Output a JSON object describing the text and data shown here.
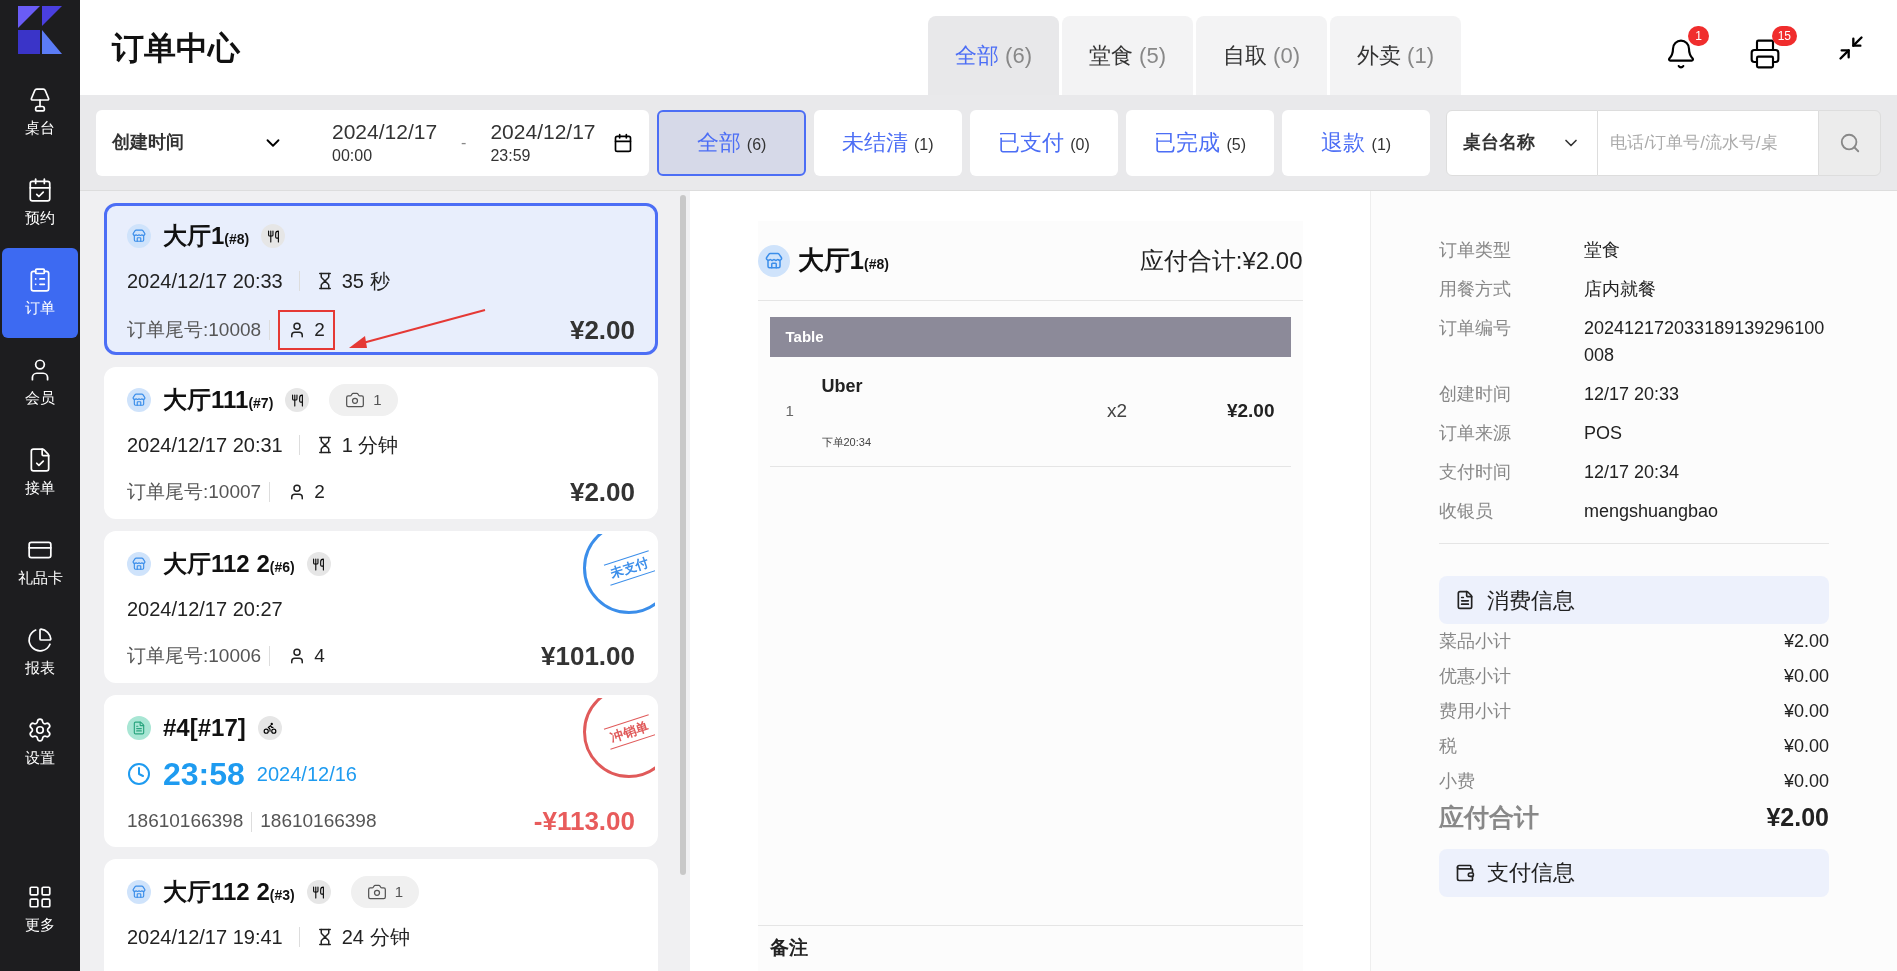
{
  "sidebar": {
    "items": [
      {
        "label": "桌台",
        "selected": false
      },
      {
        "label": "预约",
        "selected": false
      },
      {
        "label": "订单",
        "selected": true
      },
      {
        "label": "会员",
        "selected": false
      },
      {
        "label": "接单",
        "selected": false
      },
      {
        "label": "礼品卡",
        "selected": false
      },
      {
        "label": "报表",
        "selected": false
      },
      {
        "label": "设置",
        "selected": false
      },
      {
        "label": "更多",
        "selected": false
      }
    ]
  },
  "header": {
    "title": "订单中心",
    "tabs": [
      {
        "label": "全部",
        "count": "(6)",
        "selected": true
      },
      {
        "label": "堂食",
        "count": "(5)",
        "selected": false
      },
      {
        "label": "自取",
        "count": "(0)",
        "selected": false
      },
      {
        "label": "外卖",
        "count": "(1)",
        "selected": false
      }
    ],
    "notification_badge": "1",
    "print_badge": "15"
  },
  "filter": {
    "date_type": "创建时间",
    "start_date": "2024/12/17",
    "start_time": "00:00",
    "separator": "-",
    "end_date": "2024/12/17",
    "end_time": "23:59",
    "status_tabs": [
      {
        "label": "全部",
        "count": "(6)",
        "selected": true
      },
      {
        "label": "未结清",
        "count": "(1)",
        "selected": false
      },
      {
        "label": "已支付",
        "count": "(0)",
        "selected": false
      },
      {
        "label": "已完成",
        "count": "(5)",
        "selected": false
      },
      {
        "label": "退款",
        "count": "(1)",
        "selected": false
      }
    ],
    "search_type": "桌台名称",
    "search_placeholder": "电话/订单号/流水号/桌"
  },
  "orders": [
    {
      "kind": "dine_in",
      "selected": true,
      "table": "大厅1",
      "number": "(#8)",
      "datetime": "2024/12/17 20:33",
      "elapsed": "35 秒",
      "tail": "订单尾号:10008",
      "guests": "2",
      "highlighted": true,
      "amount": "¥2.00"
    },
    {
      "kind": "dine_in",
      "selected": false,
      "table": "大厅111",
      "number": "(#7)",
      "photo_count": "1",
      "datetime": "2024/12/17 20:31",
      "elapsed": "1 分钟",
      "tail": "订单尾号:10007",
      "guests": "2",
      "highlighted": false,
      "amount": "¥2.00"
    },
    {
      "kind": "dine_in",
      "selected": false,
      "table": "大厅112 2",
      "number": "(#6)",
      "datetime": "2024/12/17 20:27",
      "tail": "订单尾号:10006",
      "guests": "4",
      "highlighted": false,
      "amount": "¥101.00",
      "stamp": {
        "text": "未支付",
        "color": "#3b8eea"
      }
    },
    {
      "kind": "delivery",
      "selected": false,
      "table": "#4[#17]",
      "time": "23:58",
      "date": "2024/12/16",
      "phone": "18610166398",
      "phone_2": "18610166398",
      "amount": "-¥113.00",
      "stamp": {
        "text": "冲销单",
        "color": "#e05a5a"
      }
    },
    {
      "kind": "dine_in",
      "selected": false,
      "table": "大厅112 2",
      "number": "(#3)",
      "photo_count": "1",
      "datetime": "2024/12/17 19:41",
      "elapsed": "24 分钟"
    }
  ],
  "detail": {
    "table": "大厅1",
    "number": "(#8)",
    "total": "应付合计:¥2.00",
    "table_header": "Table",
    "items": [
      {
        "index": "1",
        "name": "Uber",
        "note": "下单20:34",
        "qty": "x2",
        "price": "¥2.00"
      }
    ],
    "remark_label": "备注"
  },
  "info": {
    "rows": [
      {
        "label": "订单类型",
        "value": "堂食"
      },
      {
        "label": "用餐方式",
        "value": "店内就餐"
      },
      {
        "label": "订单编号",
        "value": "202412172033189139296100008"
      },
      {
        "label": "创建时间",
        "value": "12/17 20:33"
      },
      {
        "label": "订单来源",
        "value": "POS"
      },
      {
        "label": "支付时间",
        "value": "12/17 20:34"
      },
      {
        "label": "收银员",
        "value": "mengshuangbao"
      }
    ],
    "consumption_title": "消费信息",
    "consumption_rows": [
      {
        "label": "菜品小计",
        "value": "¥2.00"
      },
      {
        "label": "优惠小计",
        "value": "¥0.00"
      },
      {
        "label": "费用小计",
        "value": "¥0.00"
      },
      {
        "label": "税",
        "value": "¥0.00"
      },
      {
        "label": "小费",
        "value": "¥0.00"
      }
    ],
    "total_label": "应付合计",
    "total_value": "¥2.00",
    "payment_title": "支付信息"
  }
}
